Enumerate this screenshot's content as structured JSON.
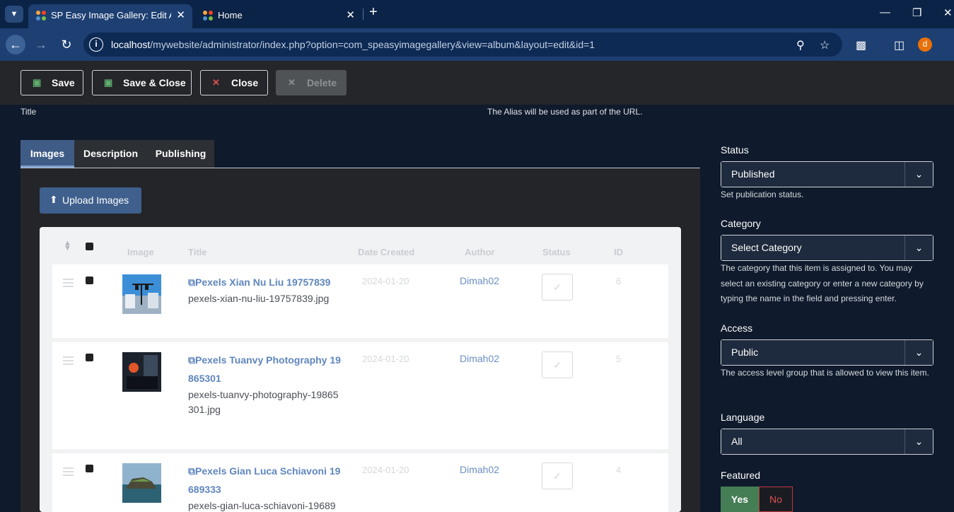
{
  "browser": {
    "tabs": [
      {
        "title": "SP Easy Image Gallery: Edit Albu",
        "active": true
      },
      {
        "title": "Home",
        "active": false
      }
    ],
    "new_tab": "+",
    "url_host": "localhost",
    "url_path": "/mywebsite/administrator/index.php?option=com_speasyimagegallery&view=album&layout=edit&id=1",
    "profile_initial": "d"
  },
  "toolbar": {
    "save": "Save",
    "save_close": "Save & Close",
    "close": "Close",
    "delete": "Delete"
  },
  "form": {
    "title_label": "Title",
    "alias_hint": "The Alias will be used as part of the URL."
  },
  "tabs": [
    "Images",
    "Description",
    "Publishing"
  ],
  "upload_button": "Upload Images",
  "table": {
    "headers": {
      "image": "Image",
      "title": "Title",
      "date": "Date Created",
      "author": "Author",
      "status": "Status",
      "id": "ID"
    },
    "rows": [
      {
        "title_line1": "Pexels Xian Nu Liu 19757839",
        "title_line2": "",
        "file_line1": "pexels-xian-nu-liu-19757839.jpg",
        "file_line2": "",
        "date": "2024-01-20",
        "author": "Dimah02",
        "id": "6"
      },
      {
        "title_line1": "Pexels Tuanvy Photography 19",
        "title_line2": "865301",
        "file_line1": "pexels-tuanvy-photography-19865",
        "file_line2": "301.jpg",
        "date": "2024-01-20",
        "author": "Dimah02",
        "id": "5"
      },
      {
        "title_line1": "Pexels Gian Luca Schiavoni 19",
        "title_line2": "689333",
        "file_line1": "pexels-gian-luca-schiavoni-19689",
        "file_line2": "",
        "date": "2024-01-20",
        "author": "Dimah02",
        "id": "4"
      }
    ]
  },
  "sidebar": {
    "status": {
      "label": "Status",
      "value": "Published",
      "desc": "Set publication status."
    },
    "category": {
      "label": "Category",
      "value": "Select Category",
      "desc": "The category that this item is assigned to. You may select an existing category or enter a new category by typing the name in the field and pressing enter."
    },
    "access": {
      "label": "Access",
      "value": "Public",
      "desc": "The access level group that is allowed to view this item."
    },
    "language": {
      "label": "Language",
      "value": "All"
    },
    "featured": {
      "label": "Featured",
      "yes": "Yes",
      "no": "No"
    }
  },
  "colors": {
    "accent": "#3f5f8c",
    "success": "#457d54",
    "danger": "#c0393b"
  }
}
